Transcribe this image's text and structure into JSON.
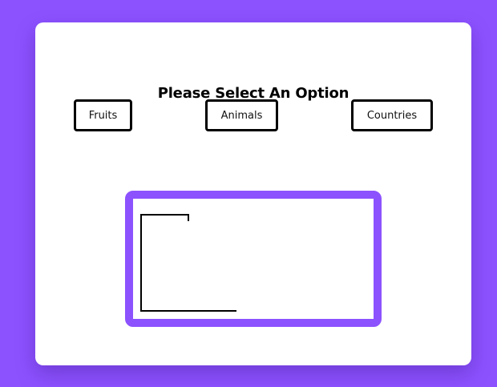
{
  "colors": {
    "background": "#8c52fe",
    "card": "#ffffff",
    "frame": "#8c52fe",
    "button_border": "#000000"
  },
  "header": {
    "title": "Please Select An Option"
  },
  "options": [
    {
      "label": "Fruits"
    },
    {
      "label": "Animals"
    },
    {
      "label": "Countries"
    }
  ],
  "canvas": {
    "icon": "hangman-gallows-icon"
  }
}
